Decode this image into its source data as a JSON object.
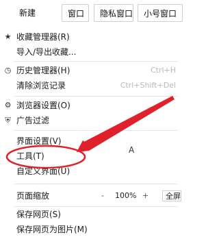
{
  "topbar": {
    "new_label": "新建",
    "window_label": "窗口",
    "private_window_label": "隐私窗口",
    "small_window_label": "小号窗口"
  },
  "menu": {
    "items": [
      {
        "icon": "star-icon",
        "label": "收藏管理器(R)",
        "shortcut": ""
      },
      {
        "icon": "",
        "label": "导入/导出收藏...",
        "shortcut": ""
      },
      {
        "icon": "clock-icon",
        "label": "历史管理器(H)",
        "shortcut": "Ctrl+H"
      },
      {
        "icon": "",
        "label": "清除浏览记录",
        "shortcut": "Ctrl+Shift+Del"
      },
      {
        "icon": "gear-icon",
        "label": "浏览器设置(O)",
        "shortcut": ""
      },
      {
        "icon": "shield-icon",
        "label": "广告过滤",
        "shortcut": ""
      },
      {
        "icon": "",
        "label": "界面设置(V)",
        "shortcut": ""
      },
      {
        "icon": "",
        "label": "工具(T)",
        "shortcut": ""
      },
      {
        "icon": "",
        "label": "自定义界面(U)",
        "shortcut": ""
      },
      {
        "icon": "",
        "label": "页面缩放",
        "shortcut": ""
      },
      {
        "icon": "",
        "label": "保存网页(S)",
        "shortcut": ""
      },
      {
        "icon": "",
        "label": "保存网页为图片(M)",
        "shortcut": ""
      }
    ],
    "zoom": {
      "minus": "-",
      "value": "100%",
      "plus": "+",
      "fullscreen": "全屏"
    }
  },
  "annotation": {
    "color": "#e0202a",
    "cursor_char": "A"
  }
}
